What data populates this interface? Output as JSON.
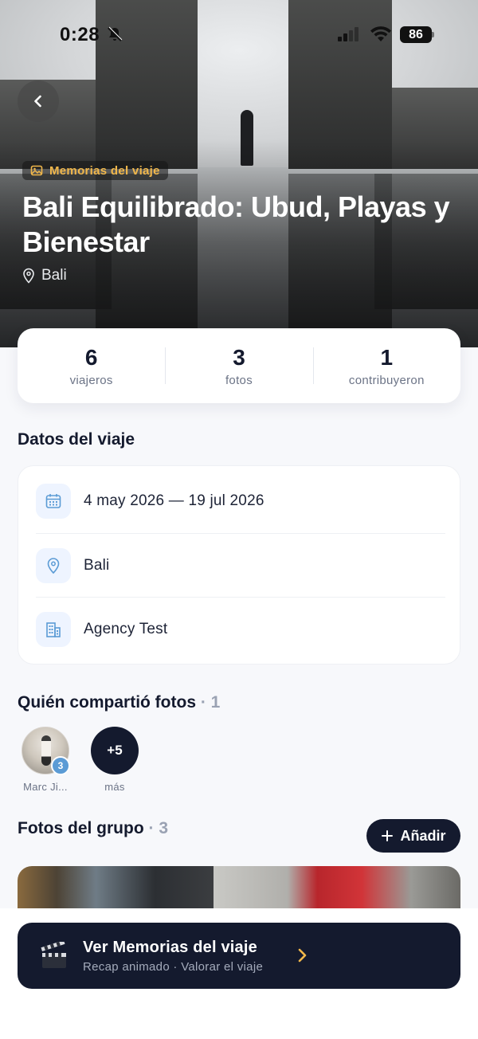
{
  "status_bar": {
    "time": "0:28",
    "battery": "86"
  },
  "hero": {
    "tag": "Memorias del viaje",
    "title": "Bali Equilibrado: Ubud, Playas y Bienestar",
    "location": "Bali"
  },
  "stats": [
    {
      "value": "6",
      "label": "viajeros"
    },
    {
      "value": "3",
      "label": "fotos"
    },
    {
      "value": "1",
      "label": "contribuyeron"
    }
  ],
  "trip_data": {
    "title": "Datos del viaje",
    "dates": "4 may 2026 — 19 jul 2026",
    "destination": "Bali",
    "agency": "Agency Test"
  },
  "contributors": {
    "title": "Quién compartió fotos",
    "count": "· 1",
    "people": [
      {
        "name": "Marc Ji...",
        "badge": "3"
      }
    ],
    "more": {
      "label": "+5",
      "caption": "más"
    }
  },
  "group_photos": {
    "title": "Fotos del grupo",
    "count": "· 3",
    "add_label": "Añadir"
  },
  "memories_cta": {
    "title": "Ver Memorias del viaje",
    "subtitle": "Recap animado · Valorar el viaje"
  },
  "colors": {
    "accent_gold": "#f2b84b",
    "navy": "#141a2e",
    "badge_blue": "#5b9bd5",
    "icon_tint": "#eef4ff"
  }
}
